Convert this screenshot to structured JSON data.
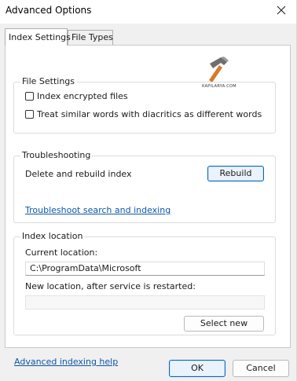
{
  "window": {
    "title": "Advanced Options",
    "close_icon": "close-icon"
  },
  "tabs": [
    {
      "label": "Index Settings",
      "active": true
    },
    {
      "label": "File Types",
      "active": false
    }
  ],
  "watermark": {
    "text": "KAPILARYA.COM",
    "icon": "hammer-icon"
  },
  "file_settings": {
    "label": "File Settings",
    "options": [
      {
        "label": "Index encrypted files",
        "checked": false
      },
      {
        "label": "Treat similar words with diacritics as different words",
        "checked": false
      }
    ]
  },
  "troubleshooting": {
    "label": "Troubleshooting",
    "rebuild_text": "Delete and rebuild index",
    "rebuild_button": "Rebuild",
    "link": "Troubleshoot search and indexing"
  },
  "index_location": {
    "label": "Index location",
    "current_label": "Current location:",
    "current_value": "C:\\ProgramData\\Microsoft",
    "new_label": "New location, after service is restarted:",
    "new_value": "",
    "select_button": "Select new"
  },
  "footer": {
    "help_link": "Advanced indexing help",
    "ok": "OK",
    "cancel": "Cancel"
  }
}
